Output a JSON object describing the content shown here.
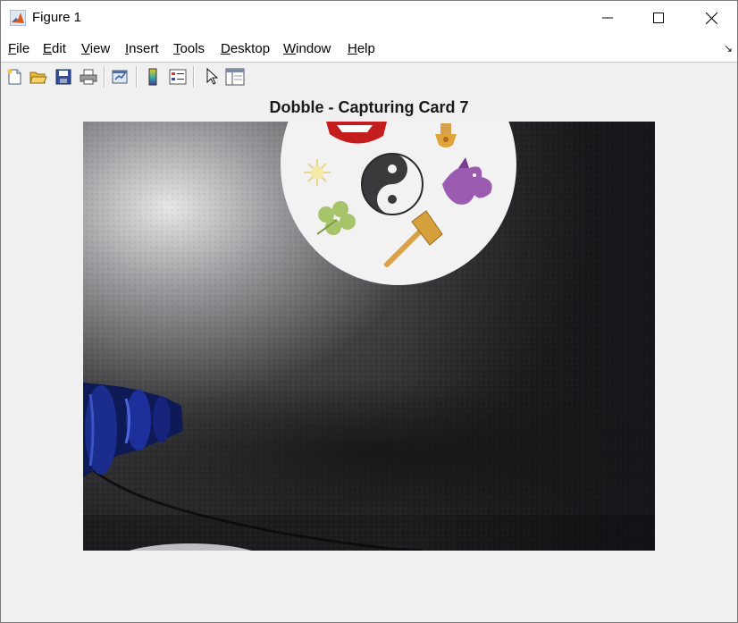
{
  "window": {
    "title": "Figure 1",
    "icon": "matlab-logo-icon",
    "controls": [
      "minimize-icon",
      "maximize-icon",
      "close-icon"
    ]
  },
  "menubar": {
    "items": [
      {
        "label": "File",
        "accel": "F",
        "rest": "ile"
      },
      {
        "label": "Edit",
        "accel": "E",
        "rest": "dit"
      },
      {
        "label": "View",
        "accel": "V",
        "rest": "iew"
      },
      {
        "label": "Insert",
        "accel": "I",
        "rest": "nsert"
      },
      {
        "label": "Tools",
        "accel": "T",
        "rest": "ools"
      },
      {
        "label": "Desktop",
        "accel": "D",
        "rest": "esktop"
      },
      {
        "label": "Window",
        "accel": "W",
        "rest": "indow"
      },
      {
        "label": "Help",
        "accel": "H",
        "rest": "elp"
      }
    ],
    "dock_icon": "dock-arrow-icon"
  },
  "toolbar": {
    "buttons": [
      "new-figure-icon",
      "open-file-icon",
      "save-icon",
      "print-icon",
      "link-plot-icon",
      "insert-colorbar-icon",
      "insert-legend-icon",
      "edit-plot-arrow-icon",
      "property-inspector-icon"
    ]
  },
  "axes": {
    "title": "Dobble - Capturing Card 7",
    "image": "webcam frame of a Dobble card on a dark textured table",
    "card_symbols": [
      "red-stop-sign",
      "candle",
      "sun",
      "yin-yang",
      "purple-dragon",
      "clover",
      "hammer"
    ]
  },
  "colors": {
    "titlebar_bg": "#ffffff",
    "figure_bg": "#f0f0f0",
    "table_dark": "#2a2a2a",
    "card_white": "#f2f2f2"
  }
}
